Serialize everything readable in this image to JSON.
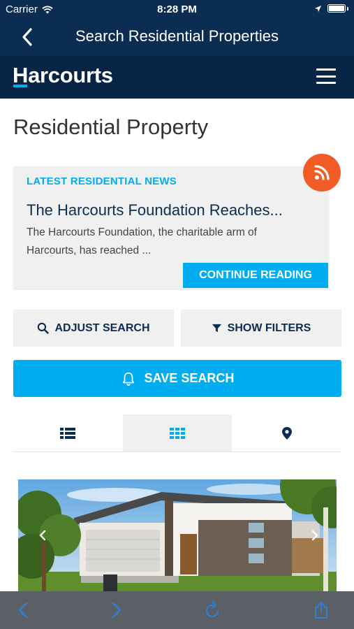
{
  "status_bar": {
    "carrier": "Carrier",
    "time": "8:28 PM"
  },
  "nav": {
    "title": "Search Residential Properties"
  },
  "brand": {
    "logo_text": "Harcourts"
  },
  "page": {
    "title": "Residential Property"
  },
  "news": {
    "kicker": "LATEST RESIDENTIAL NEWS",
    "headline": "The Harcourts Foundation Reaches...",
    "excerpt": "The Harcourts Foundation, the charitable arm of Harcourts, has reached ...",
    "cta": "CONTINUE READING"
  },
  "actions": {
    "adjust_search": "ADJUST SEARCH",
    "show_filters": "SHOW FILTERS",
    "save_search": "SAVE SEARCH"
  },
  "view_tabs": {
    "active": "grid"
  },
  "colors": {
    "navy": "#062445",
    "nav_blue": "#0b2d52",
    "accent": "#00adef",
    "rss": "#f25c24",
    "toolbar": "#5b6066"
  }
}
